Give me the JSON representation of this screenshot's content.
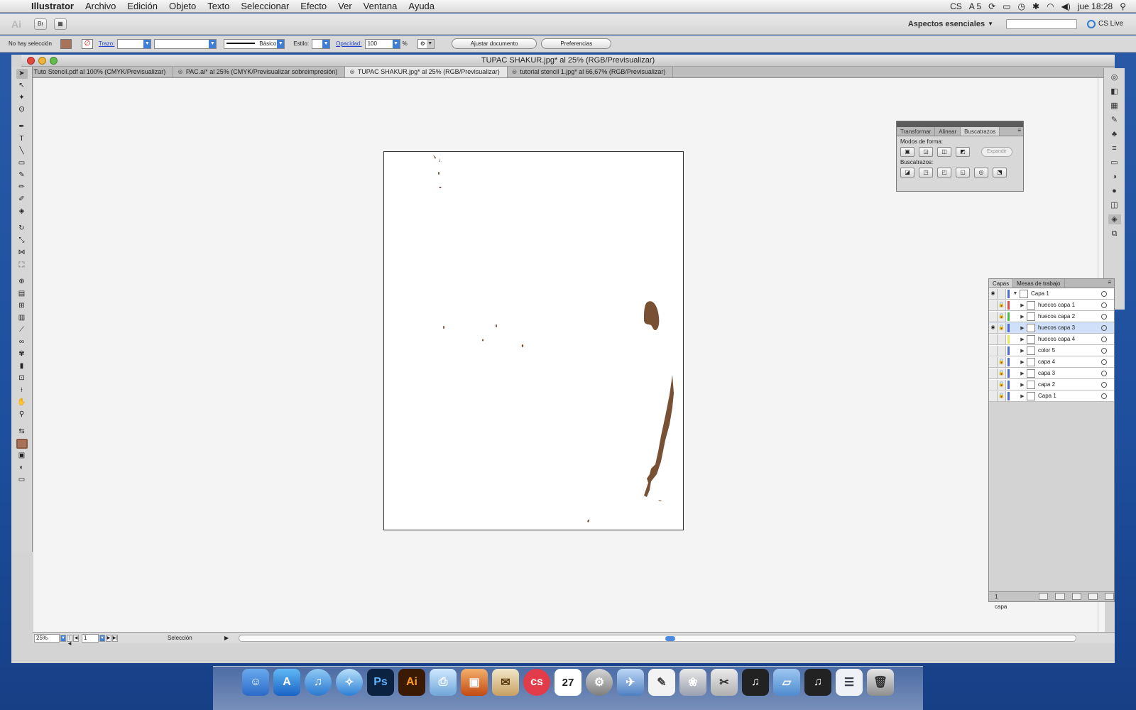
{
  "menubar": {
    "app": "Illustrator",
    "items": [
      "Archivo",
      "Edición",
      "Objeto",
      "Texto",
      "Seleccionar",
      "Efecto",
      "Ver",
      "Ventana",
      "Ayuda"
    ],
    "status_icons": [
      "CS",
      "A 5"
    ],
    "clock": "jue 18:28"
  },
  "appbar": {
    "logo": "Ai",
    "bridge": "Br",
    "workspace": "Aspectos esenciales",
    "search_placeholder": "",
    "cslive": "CS Live"
  },
  "controlbar": {
    "selection": "No hay selección",
    "stroke_label": "Trazo:",
    "stroke_profile": "Básico",
    "style_label": "Estilo:",
    "opacity_label": "Opacidad:",
    "opacity_value": "100",
    "percent": "%",
    "fit_button": "Ajustar documento",
    "prefs_button": "Preferencias",
    "fill_color": "#a8735a"
  },
  "window": {
    "title": "TUPAC SHAKUR.jpg* al 25% (RGB/Previsualizar)",
    "tabs": [
      {
        "label": "Tuto Stencil.pdf al 100% (CMYK/Previsualizar)",
        "active": false
      },
      {
        "label": "PAC.ai* al 25% (CMYK/Previsualizar sobreimpresión)",
        "active": false
      },
      {
        "label": "TUPAC SHAKUR.jpg* al 25% (RGB/Previsualizar)",
        "active": true
      },
      {
        "label": "tutorial stencil 1.jpg* al 66,67% (RGB/Previsualizar)",
        "active": false
      }
    ]
  },
  "pathfinder": {
    "tabs": [
      "Transformar",
      "Alinear",
      "Buscatrazos"
    ],
    "active_tab": "Buscatrazos",
    "shape_modes_label": "Modos de forma:",
    "expand_button": "Expandir",
    "pathfinders_label": "Buscatrazos:"
  },
  "layers": {
    "tabs": [
      "Capas",
      "Mesas de trabajo"
    ],
    "rows": [
      {
        "name": "Capa 1",
        "color": "#4c6bd6",
        "visible": true,
        "locked": false,
        "top": true
      },
      {
        "name": "huecos capa 1",
        "color": "#e34a4a",
        "visible": false,
        "locked": true
      },
      {
        "name": "huecos capa 2",
        "color": "#4bbf4b",
        "visible": false,
        "locked": true
      },
      {
        "name": "huecos capa 3",
        "color": "#4c6bd6",
        "visible": true,
        "locked": true,
        "selected": true
      },
      {
        "name": "huecos capa 4",
        "color": "#e8e85a",
        "visible": false,
        "locked": false
      },
      {
        "name": "color 5",
        "color": "#4c6bd6",
        "visible": false,
        "locked": false
      },
      {
        "name": "capa 4",
        "color": "#4c6bd6",
        "visible": false,
        "locked": true
      },
      {
        "name": "capa 3",
        "color": "#4c6bd6",
        "visible": false,
        "locked": true
      },
      {
        "name": "capa 2",
        "color": "#4c6bd6",
        "visible": false,
        "locked": true
      },
      {
        "name": "Capa 1",
        "color": "#4c6bd6",
        "visible": false,
        "locked": true
      }
    ],
    "footer": "1 capa"
  },
  "statusbar": {
    "zoom": "25%",
    "page": "1",
    "status": "Selección"
  },
  "colors": {
    "shape_brown": "#785034"
  },
  "dock": {
    "items": [
      "finder-icon",
      "app-store-icon",
      "itunes-icon",
      "safari-icon",
      "photoshop-icon",
      "illustrator-icon",
      "preview-icon",
      "iphoto-icon",
      "ical-icon",
      "lastfm-icon",
      "calendar-icon",
      "system-preferences-icon",
      "mail-icon",
      "textedit-icon",
      "photos-icon",
      "scissors-icon",
      "music-icon",
      "folder-icon",
      "music2-icon",
      "document-icon",
      "trash-icon"
    ],
    "ps": "Ps",
    "ai": "Ai",
    "cal": "27"
  }
}
